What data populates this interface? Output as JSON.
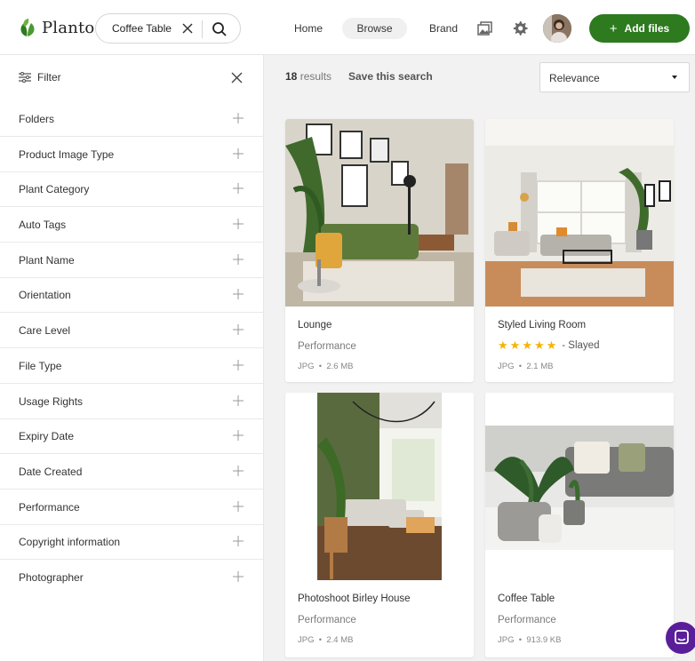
{
  "header": {
    "brand": "Planto",
    "search_value": "Coffee Table",
    "nav": [
      "Home",
      "Browse",
      "Brand"
    ],
    "add_label": "Add files",
    "accent": "#2d7a1f"
  },
  "sidebar": {
    "title": "Filter",
    "facets": [
      "Folders",
      "Product Image Type",
      "Plant Category",
      "Auto Tags",
      "Plant Name",
      "Orientation",
      "Care Level",
      "File Type",
      "Usage Rights",
      "Expiry Date",
      "Date Created",
      "Performance",
      "Copyright information",
      "Photographer"
    ]
  },
  "results": {
    "count": "18",
    "count_suffix": "results",
    "save_search": "Save this search",
    "sort_value": "Relevance"
  },
  "cards": [
    {
      "title": "Lounge",
      "subtitle": "Performance",
      "format": "JPG",
      "size": "2.6 MB"
    },
    {
      "title": "Styled Living Room",
      "rating": 5,
      "rating_label": "- Slayed",
      "format": "JPG",
      "size": "2.1 MB"
    },
    {
      "title": "Photoshoot Birley House",
      "subtitle": "Performance",
      "format": "JPG",
      "size": "2.4 MB"
    },
    {
      "title": "Coffee Table",
      "subtitle": "Performance",
      "format": "JPG",
      "size": "913.9 KB"
    }
  ],
  "icons": {
    "logo": "leaf-icon",
    "clear": "close-icon",
    "search": "search-icon",
    "gallery": "image-icon",
    "settings": "gear-icon",
    "filter": "filter-icon",
    "expand": "plus-icon",
    "sort": "caret-down-icon",
    "chat": "chat-icon"
  }
}
